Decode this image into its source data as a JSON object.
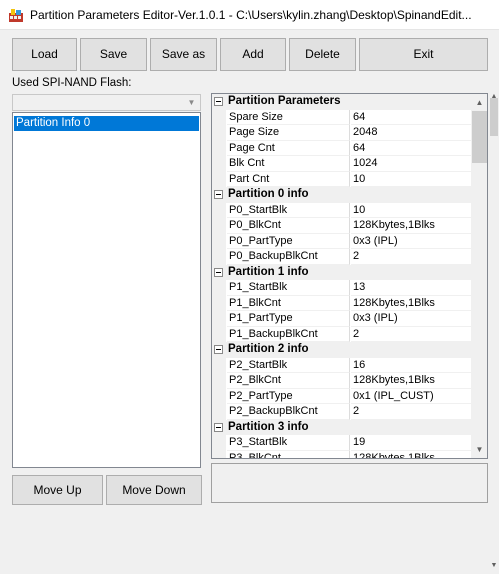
{
  "window": {
    "title": "Partition Parameters Editor-Ver.1.0.1 - C:\\Users\\kylin.zhang\\Desktop\\SpinandEdit..."
  },
  "toolbar": {
    "load": "Load",
    "save": "Save",
    "save_as": "Save as",
    "add": "Add",
    "delete": "Delete",
    "exit": "Exit"
  },
  "sidebar": {
    "flash_label": "Used SPI-NAND Flash:",
    "flash_value": "",
    "items": [
      "Partition Info 0"
    ],
    "selected_index": 0
  },
  "property_grid": {
    "rows": [
      {
        "type": "category",
        "name": "Partition Parameters"
      },
      {
        "type": "prop",
        "name": "Spare Size",
        "value": "64"
      },
      {
        "type": "prop",
        "name": "Page Size",
        "value": "2048"
      },
      {
        "type": "prop",
        "name": "Page Cnt",
        "value": "64"
      },
      {
        "type": "prop",
        "name": "Blk Cnt",
        "value": "1024"
      },
      {
        "type": "prop",
        "name": "Part Cnt",
        "value": "10"
      },
      {
        "type": "category",
        "name": "Partition 0 info"
      },
      {
        "type": "prop",
        "name": "P0_StartBlk",
        "value": "10"
      },
      {
        "type": "prop",
        "name": "P0_BlkCnt",
        "value": "128Kbytes,1Blks"
      },
      {
        "type": "prop",
        "name": "P0_PartType",
        "value": "0x3 (IPL)"
      },
      {
        "type": "prop",
        "name": "P0_BackupBlkCnt",
        "value": "2"
      },
      {
        "type": "category",
        "name": "Partition 1 info"
      },
      {
        "type": "prop",
        "name": "P1_StartBlk",
        "value": "13"
      },
      {
        "type": "prop",
        "name": "P1_BlkCnt",
        "value": "128Kbytes,1Blks"
      },
      {
        "type": "prop",
        "name": "P1_PartType",
        "value": "0x3 (IPL)"
      },
      {
        "type": "prop",
        "name": "P1_BackupBlkCnt",
        "value": "2"
      },
      {
        "type": "category",
        "name": "Partition 2 info"
      },
      {
        "type": "prop",
        "name": "P2_StartBlk",
        "value": "16"
      },
      {
        "type": "prop",
        "name": "P2_BlkCnt",
        "value": "128Kbytes,1Blks"
      },
      {
        "type": "prop",
        "name": "P2_PartType",
        "value": "0x1 (IPL_CUST)"
      },
      {
        "type": "prop",
        "name": "P2_BackupBlkCnt",
        "value": "2"
      },
      {
        "type": "category",
        "name": "Partition 3 info"
      },
      {
        "type": "prop",
        "name": "P3_StartBlk",
        "value": "19"
      },
      {
        "type": "prop",
        "name": "P3_BlkCnt",
        "value": "128Kbytes,1Blks"
      }
    ]
  },
  "bottom": {
    "move_up": "Move Up",
    "move_down": "Move Down"
  },
  "icons": {
    "app": "app-icon",
    "expander": "collapse-minus-icon",
    "dropdown": "chevron-down-icon"
  },
  "colors": {
    "selection": "#0078d7",
    "window_bg": "#f0f0f0"
  }
}
